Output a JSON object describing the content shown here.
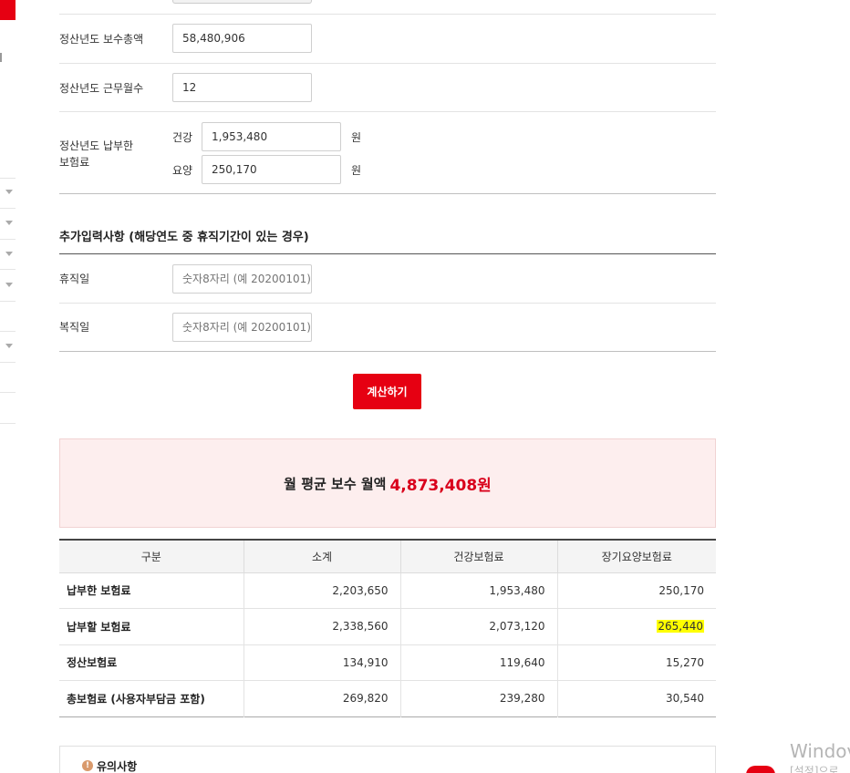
{
  "form": {
    "total_pay_label": "정산년도 보수총액",
    "total_pay_value": "58,480,906",
    "work_months_label": "정산년도 근무월수",
    "work_months_value": "12",
    "paid_insurance_label_line1": "정산년도 납부한",
    "paid_insurance_label_line2": "보험료",
    "health_label": "건강",
    "health_value": "1,953,480",
    "care_label": "요양",
    "care_value": "250,170",
    "unit": "원"
  },
  "extra": {
    "section_title": "추가입력사항 (해당연도 중 휴직기간이 있는 경우)",
    "leave_label": "휴직일",
    "leave_placeholder": "숫자8자리 (예 20200101)",
    "return_label": "복직일",
    "return_placeholder": "숫자8자리 (예 20200101)"
  },
  "calculate_button": "계산하기",
  "result": {
    "label": "월 평균 보수 월액",
    "value": "4,873,408원"
  },
  "table": {
    "headers": [
      "구분",
      "소계",
      "건강보험료",
      "장기요양보험료"
    ],
    "rows": [
      [
        "납부한 보험료",
        "2,203,650",
        "1,953,480",
        "250,170"
      ],
      [
        "납부할 보험료",
        "2,338,560",
        "2,073,120",
        "265,440"
      ],
      [
        "정산보험료",
        "134,910",
        "119,640",
        "15,270"
      ],
      [
        "총보험료 (사용자부담금 포함)",
        "269,820",
        "239,280",
        "30,540"
      ]
    ]
  },
  "notice": {
    "icon": "exclamation-icon",
    "title": "유의사항"
  },
  "os_overlay": {
    "line1": "Windov",
    "line2": "[설정]으로"
  },
  "colors": {
    "accent": "#e60012",
    "result_value": "#d9001b",
    "result_bg": "#fdeeee",
    "highlight": "#ffff00"
  }
}
